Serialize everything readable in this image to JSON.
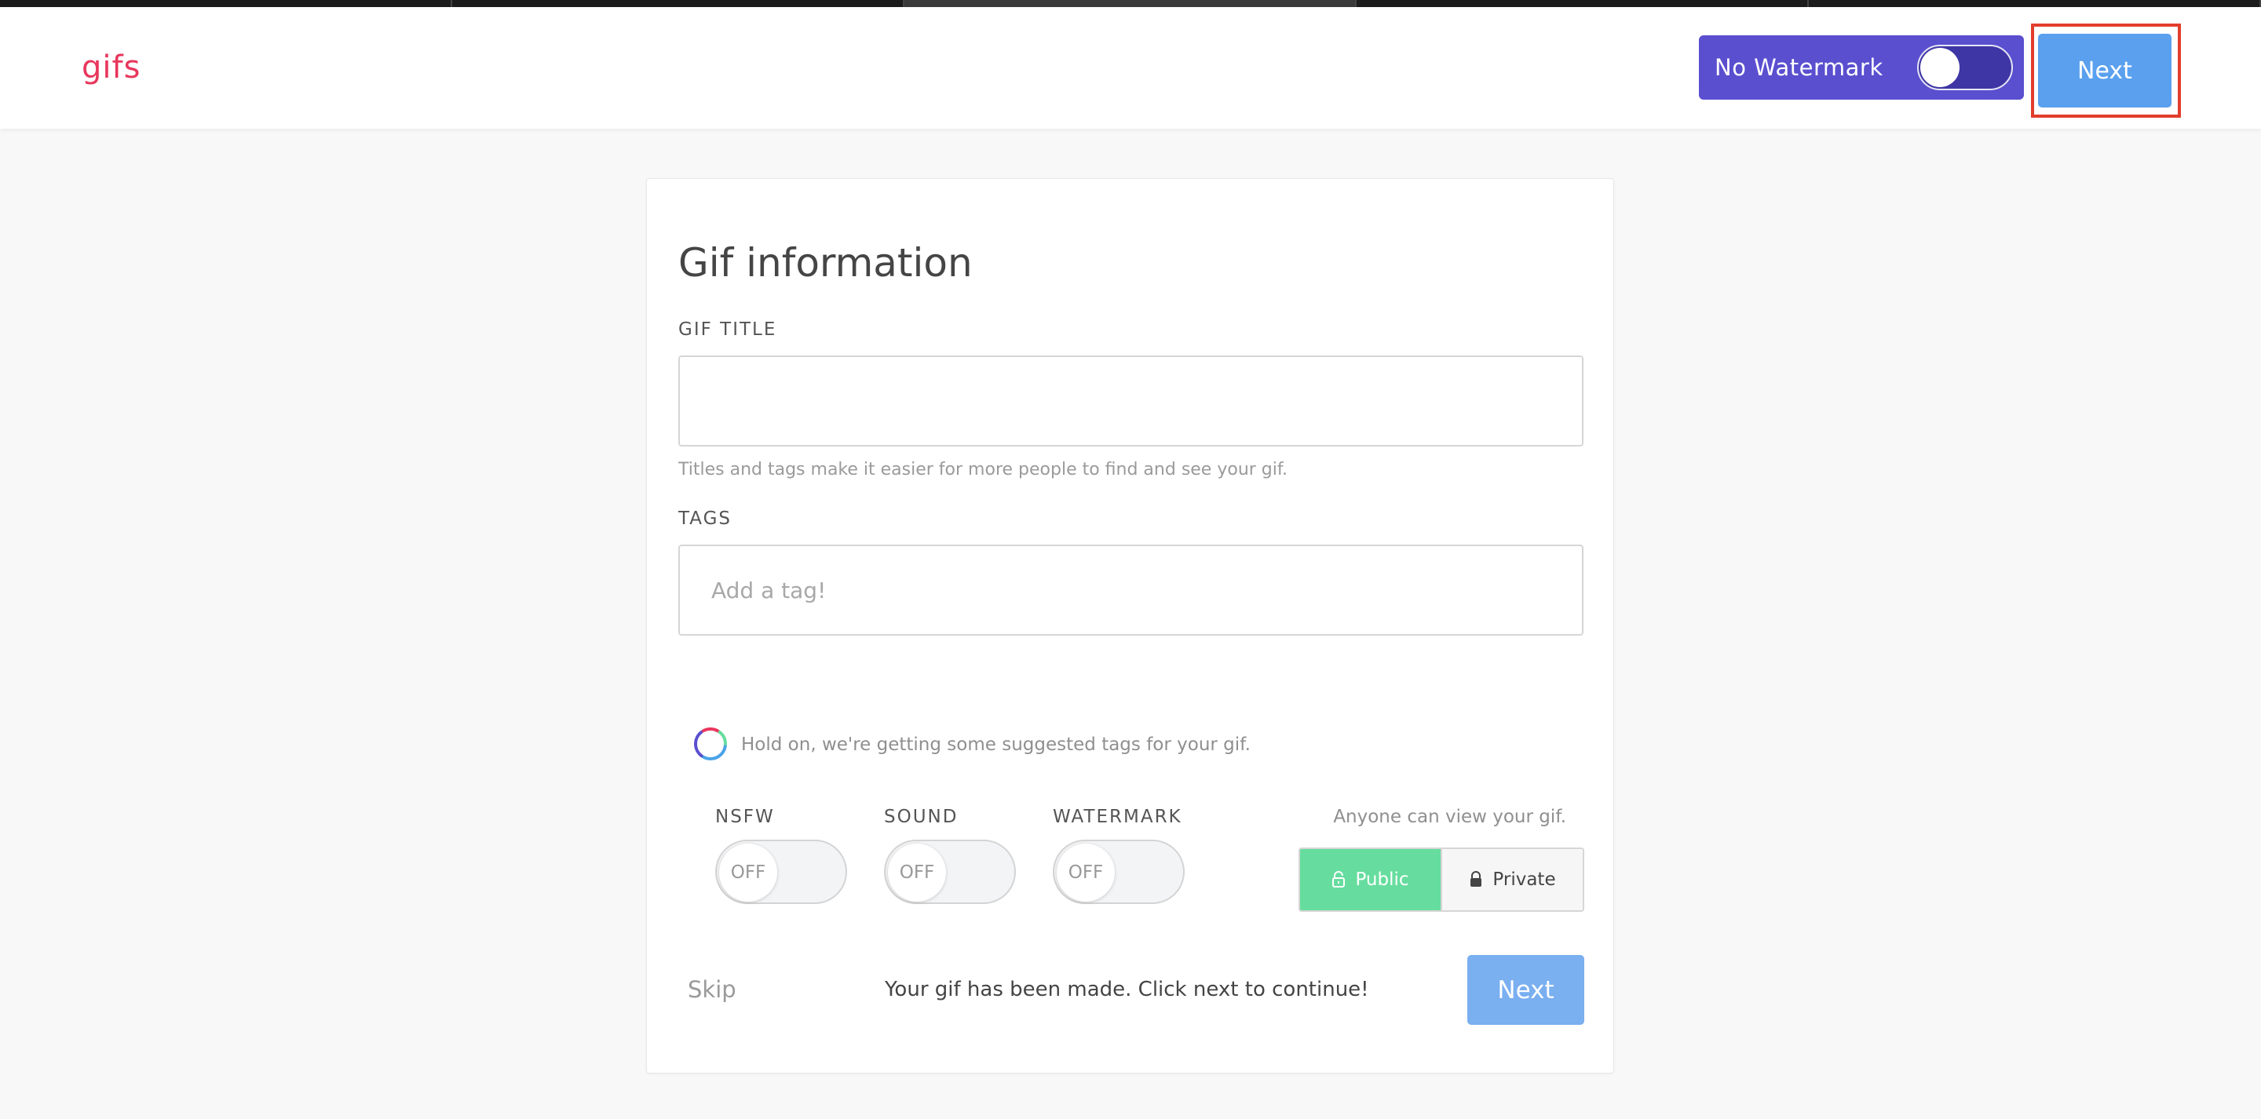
{
  "browser": {
    "tab_count": 5,
    "active_tab": 2
  },
  "header": {
    "logo": "gifs",
    "watermark_toggle": {
      "label": "No Watermark",
      "on": false
    },
    "next_label": "Next"
  },
  "form": {
    "title": "Gif information",
    "gif_title": {
      "label": "GIF TITLE",
      "value": "",
      "placeholder": ""
    },
    "hint": "Titles and tags make it easier for more people to find and see your gif.",
    "tags": {
      "label": "TAGS",
      "value": "",
      "placeholder": "Add a tag!"
    },
    "loading_text": "Hold on, we're getting some suggested tags for your gif.",
    "switches": [
      {
        "label": "NSFW",
        "state": "OFF"
      },
      {
        "label": "SOUND",
        "state": "OFF"
      },
      {
        "label": "WATERMARK",
        "state": "OFF"
      }
    ],
    "visibility": {
      "text": "Anyone can view your gif.",
      "public_label": "Public",
      "private_label": "Private",
      "selected": "Public"
    },
    "skip_label": "Skip",
    "status_text": "Your gif has been made. Click next to continue!",
    "next_label": "Next"
  },
  "colors": {
    "brand": "#e8365d",
    "watermark_pill": "#5a4fcf",
    "next_button": "#5aa0ee",
    "public_selected": "#66dd9e",
    "highlight_frame": "#e23d2c"
  }
}
